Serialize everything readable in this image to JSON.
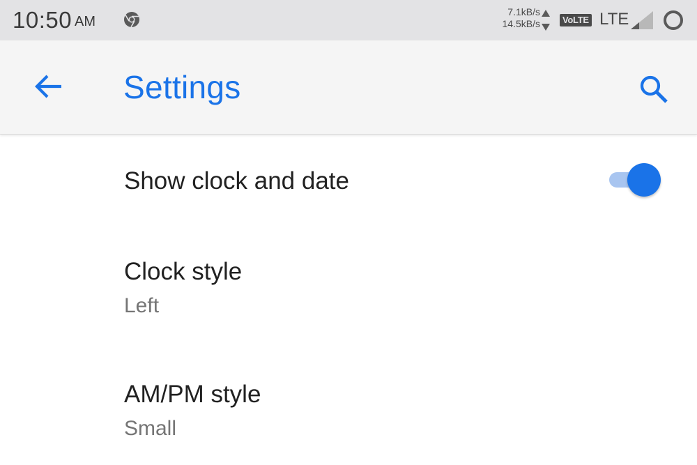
{
  "status_bar": {
    "time": "10:50",
    "ampm": "AM",
    "upload_speed": "7.1kB/s",
    "download_speed": "14.5kB/s",
    "volte_label": "VoLTE",
    "network_label": "LTE",
    "notification_icon": "chrome-like-icon",
    "signal_icon": "signal-icon",
    "battery_icon": "battery-ring-icon"
  },
  "app_bar": {
    "title": "Settings",
    "back_icon": "arrow-back-icon",
    "search_icon": "search-icon"
  },
  "settings": {
    "items": [
      {
        "title": "Show clock and date",
        "toggle_on": true
      },
      {
        "title": "Clock style",
        "summary": "Left"
      },
      {
        "title": "AM/PM style",
        "summary": "Small"
      }
    ]
  },
  "colors": {
    "accent": "#1a73e8",
    "status_bar_bg": "#e3e3e5",
    "app_bar_bg": "#f5f5f5",
    "toggle_track_on": "#a8c5f0"
  }
}
